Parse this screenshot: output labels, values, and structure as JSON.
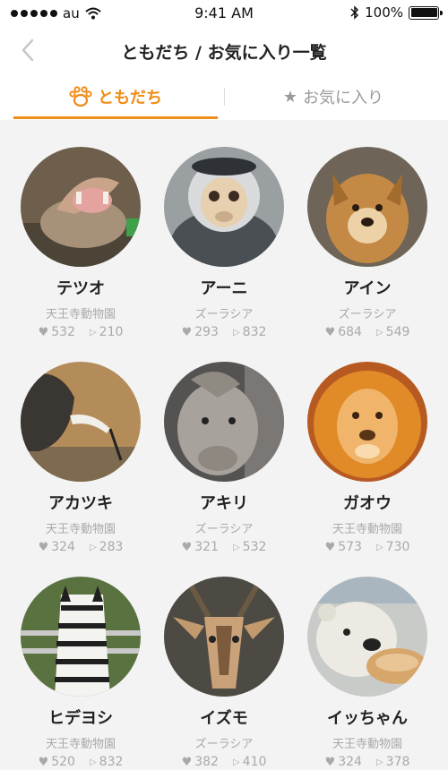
{
  "status": {
    "carrier": "au",
    "time": "9:41 AM",
    "battery": "100%"
  },
  "nav": {
    "title": "ともだち / お気に入り一覧"
  },
  "tabs": {
    "friends": "ともだち",
    "favorites": "お気に入り"
  },
  "animals": [
    {
      "name": "テツオ",
      "zoo": "天王寺動物園",
      "likes": "532",
      "plays": "210",
      "icon": "hippo"
    },
    {
      "name": "アーニ",
      "zoo": "ズーラシア",
      "likes": "293",
      "plays": "832",
      "icon": "monkey"
    },
    {
      "name": "アイン",
      "zoo": "ズーラシア",
      "likes": "684",
      "plays": "549",
      "icon": "dog"
    },
    {
      "name": "アカツキ",
      "zoo": "天王寺動物園",
      "likes": "324",
      "plays": "283",
      "icon": "bird"
    },
    {
      "name": "アキリ",
      "zoo": "ズーラシア",
      "likes": "321",
      "plays": "532",
      "icon": "rhino"
    },
    {
      "name": "ガオウ",
      "zoo": "天王寺動物園",
      "likes": "573",
      "plays": "730",
      "icon": "lion"
    },
    {
      "name": "ヒデヨシ",
      "zoo": "天王寺動物園",
      "likes": "520",
      "plays": "832",
      "icon": "zebra"
    },
    {
      "name": "イズモ",
      "zoo": "ズーラシア",
      "likes": "382",
      "plays": "410",
      "icon": "antelope"
    },
    {
      "name": "イッちゃん",
      "zoo": "天王寺動物園",
      "likes": "324",
      "plays": "378",
      "icon": "polar-bear"
    }
  ]
}
